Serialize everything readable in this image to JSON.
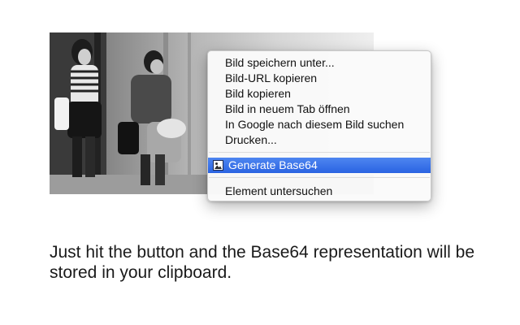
{
  "context_menu": {
    "items": [
      {
        "label": "Bild speichern unter..."
      },
      {
        "label": "Bild-URL kopieren"
      },
      {
        "label": "Bild kopieren"
      },
      {
        "label": "Bild in neuem Tab öffnen"
      },
      {
        "label": "In Google nach diesem Bild suchen"
      },
      {
        "label": "Drucken..."
      }
    ],
    "extension_item": {
      "label": "Generate Base64",
      "icon": "image-icon",
      "highlighted": true
    },
    "inspect_item": {
      "label": "Element untersuchen"
    },
    "highlight_color": "#2a63e2"
  },
  "photo": {
    "style": "black-and-white street photo, two women walking with bags"
  },
  "caption": {
    "text": "Just hit the button and the Base64 representation will be stored in your clipboard."
  }
}
